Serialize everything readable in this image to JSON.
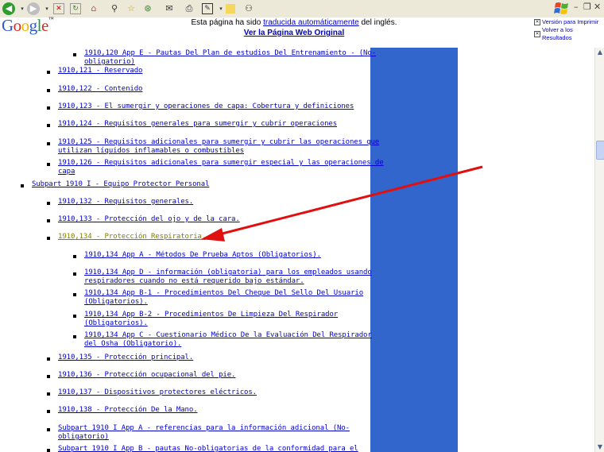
{
  "browser": {
    "toolbar_icons": [
      "back-icon",
      "forward-icon",
      "stop-icon",
      "refresh-icon",
      "home-icon",
      "search-icon",
      "favorites-icon",
      "history-icon",
      "mail-icon",
      "print-icon",
      "edit-icon",
      "discuss-icon",
      "messenger-icon"
    ],
    "window_controls": {
      "minimize": "–",
      "restore": "❐",
      "close": "✕"
    }
  },
  "translate_bar": {
    "logo": "Google",
    "notice_prefix": "Esta página ha sido ",
    "notice_link": "traducida automáticamente",
    "notice_suffix": " del inglés.",
    "original_link": "Ver la Página Web Original",
    "print_version": "Versión para Imprimir",
    "back_to_results": "Volver a los Resultados"
  },
  "colors": {
    "link": "#0000cc",
    "visited_link": "#808000",
    "column": "#3366cc",
    "arrow": "#e01010"
  },
  "content": {
    "items": [
      {
        "text": "1910,120 App E - Pautas Del Plan de estudios Del Entrenamiento - (No-",
        "text2": "obligatorio)"
      },
      {
        "text": "1910,121 - Reservado"
      },
      {
        "text": "1910,122 - Contenido"
      },
      {
        "text": "1910,123 - El sumergir y operaciones de capa: Cobertura y definiciones"
      },
      {
        "text": "1910,124 - Requisitos generales para sumergir y cubrir operaciones"
      },
      {
        "text": "1910,125 - Requisitos adicionales para sumergir y cubrir las operaciones que",
        "text2": "utilizan líquidos inflamables o combustibles"
      },
      {
        "text": "1910,126 - Requisitos adicionales para sumergir especial y las operaciones de",
        "text2": "capa"
      },
      {
        "text": "Subpart 1910 I - Equipo Protector Personal"
      },
      {
        "text": "1910,132 - Requisitos generales."
      },
      {
        "text": "1910,133 - Protección del ojo y de la cara."
      },
      {
        "text": "1910,134 - Protección Respiratoria."
      },
      {
        "text": "1910,134 App A - Métodos De Prueba Aptos (Obligatorios)."
      },
      {
        "text": "1910,134 App D - información (obligatoria) para los empleados usando",
        "text2": "respiradores cuando no está requerido bajo estándar."
      },
      {
        "text": "1910,134 App B-1 - Procedimientos Del Cheque Del Sello Del Usuario",
        "text2": "(Obligatorios)."
      },
      {
        "text": "1910,134 App B-2 - Procedimientos De Limpieza Del Respirador",
        "text2": "(Obligatorios)."
      },
      {
        "text": "1910,134 App C - Cuestionario Médico De la Evaluación Del Respirador",
        "text2": "del Osha (Obligatorio)."
      },
      {
        "text": "1910,135 - Protección principal."
      },
      {
        "text": "1910,136 - Protección ocupacional del pie."
      },
      {
        "text": "1910,137 - Dispositivos protectores eléctricos."
      },
      {
        "text": "1910,138 - Protección De la Mano."
      },
      {
        "text": "Subpart 1910 I App A - referencias para la información adicional (No-",
        "text2": "obligatorio)"
      },
      {
        "text": "Subpart 1910 I App B - pautas No-obligatorias de la conformidad para el"
      }
    ]
  }
}
